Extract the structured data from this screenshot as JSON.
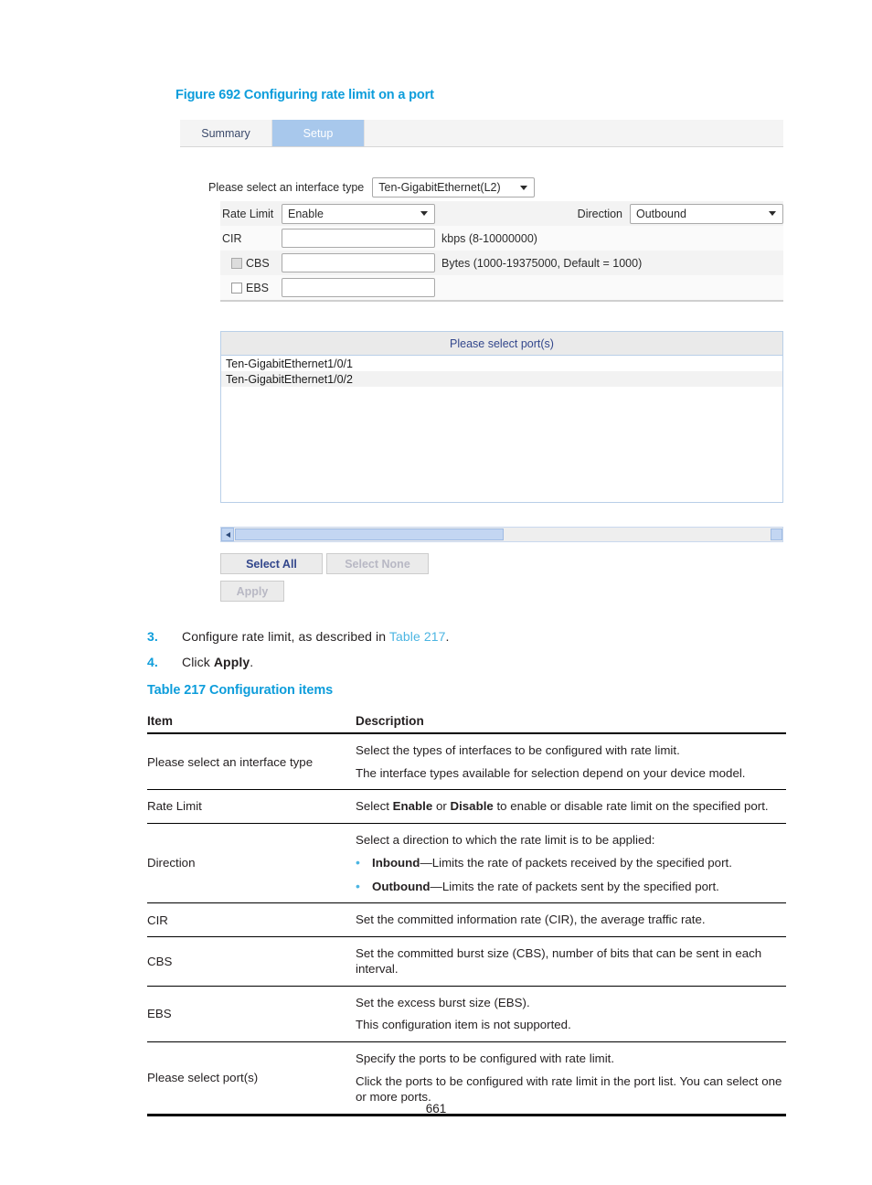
{
  "figure": {
    "caption": "Figure 692 Configuring rate limit on a port",
    "tabs": [
      {
        "label": "Summary",
        "active": false
      },
      {
        "label": "Setup",
        "active": true
      }
    ],
    "interface_type": {
      "label": "Please select an interface type",
      "value": "Ten-GigabitEthernet(L2)"
    },
    "rate_limit": {
      "label": "Rate Limit",
      "value": "Enable"
    },
    "direction": {
      "label": "Direction",
      "value": "Outbound"
    },
    "cir": {
      "label": "CIR",
      "value": "",
      "unit": "kbps (8-10000000)"
    },
    "cbs": {
      "label": "CBS",
      "value": "",
      "unit": "Bytes (1000-19375000, Default = 1000)",
      "checked": false
    },
    "ebs": {
      "label": "EBS",
      "value": "",
      "unit": "",
      "checked": false
    },
    "port_list": {
      "header": "Please select port(s)",
      "ports": [
        "Ten-GigabitEthernet1/0/1",
        "Ten-GigabitEthernet1/0/2"
      ]
    },
    "buttons": {
      "select_all": "Select All",
      "select_none": "Select None",
      "apply": "Apply"
    }
  },
  "steps": [
    {
      "num": "3.",
      "text_before": "Configure rate limit, as described in ",
      "link": "Table 217",
      "text_after": "."
    },
    {
      "num": "4.",
      "text_before": "Click ",
      "bold": "Apply",
      "text_after": "."
    }
  ],
  "table": {
    "caption": "Table 217 Configuration items",
    "headers": [
      "Item",
      "Description"
    ],
    "rows": [
      {
        "item": "Please select an interface type",
        "lines": [
          "Select the types of interfaces to be configured with rate limit.",
          "The interface types available for selection depend on your device model."
        ]
      },
      {
        "item": "Rate Limit",
        "rich": {
          "prefix": "Select ",
          "b1": "Enable",
          "mid": " or ",
          "b2": "Disable",
          "suffix": " to enable or disable rate limit on the specified port."
        }
      },
      {
        "item": "Direction",
        "intro": "Select a direction to which the rate limit is to be applied:",
        "bullets": [
          {
            "bold": "Inbound",
            "text": "—Limits the rate of packets received by the specified port."
          },
          {
            "bold": "Outbound",
            "text": "—Limits the rate of packets sent by the specified port."
          }
        ]
      },
      {
        "item": "CIR",
        "lines": [
          "Set the committed information rate (CIR), the average traffic rate."
        ]
      },
      {
        "item": "CBS",
        "lines": [
          "Set the committed burst size (CBS), number of bits that can be sent in each interval."
        ]
      },
      {
        "item": "EBS",
        "lines": [
          "Set the excess burst size (EBS).",
          "This configuration item is not supported."
        ]
      },
      {
        "item": "Please select port(s)",
        "lines": [
          "Specify the ports to be configured with rate limit.",
          "Click the ports to be configured with rate limit in the port list. You can select one or more ports."
        ]
      }
    ]
  },
  "page_number": "661",
  "colors": {
    "accent_blue": "#0d9ddb",
    "link_blue": "#4bb5e2",
    "tab_active": "#a8c8ec",
    "scroll_blue": "#c3d6f2"
  }
}
